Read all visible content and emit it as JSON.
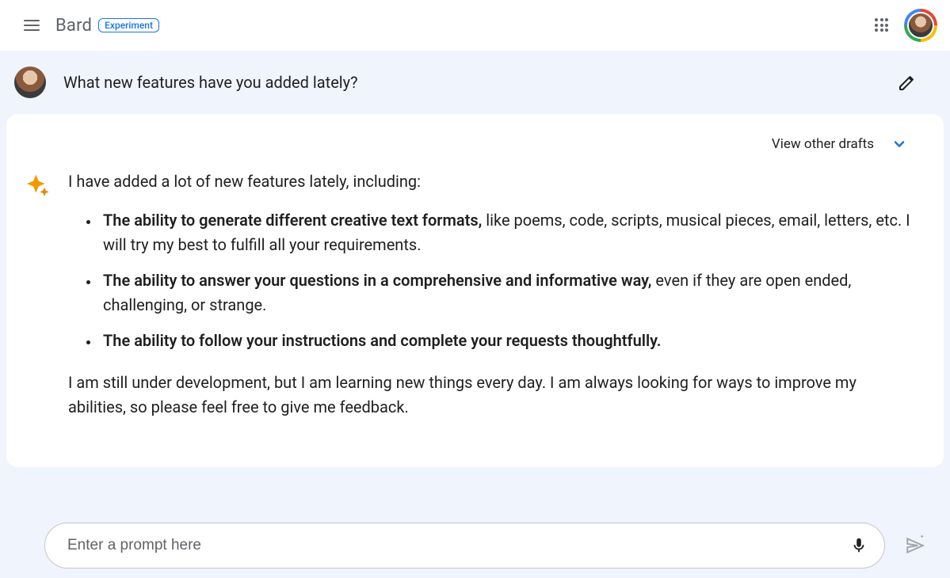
{
  "header": {
    "brand": "Bard",
    "badge": "Experiment"
  },
  "conversation": {
    "user_prompt": "What new features have you added lately?",
    "drafts_label": "View other drafts",
    "response": {
      "intro": "I have added a lot of new features lately, including:",
      "bullets": [
        {
          "bold": "The ability to generate different creative text formats,",
          "rest": " like poems, code, scripts, musical pieces, email, letters, etc. I will try my best to fulfill all your requirements."
        },
        {
          "bold": "The ability to answer your questions in a comprehensive and informative way,",
          "rest": " even if they are open ended, challenging, or strange."
        },
        {
          "bold": "The ability to follow your instructions and complete your requests thoughtfully.",
          "rest": ""
        }
      ],
      "outro": "I am still under development, but I am learning new things every day. I am always looking for ways to improve my abilities, so please feel free to give me feedback."
    }
  },
  "input": {
    "placeholder": "Enter a prompt here"
  }
}
